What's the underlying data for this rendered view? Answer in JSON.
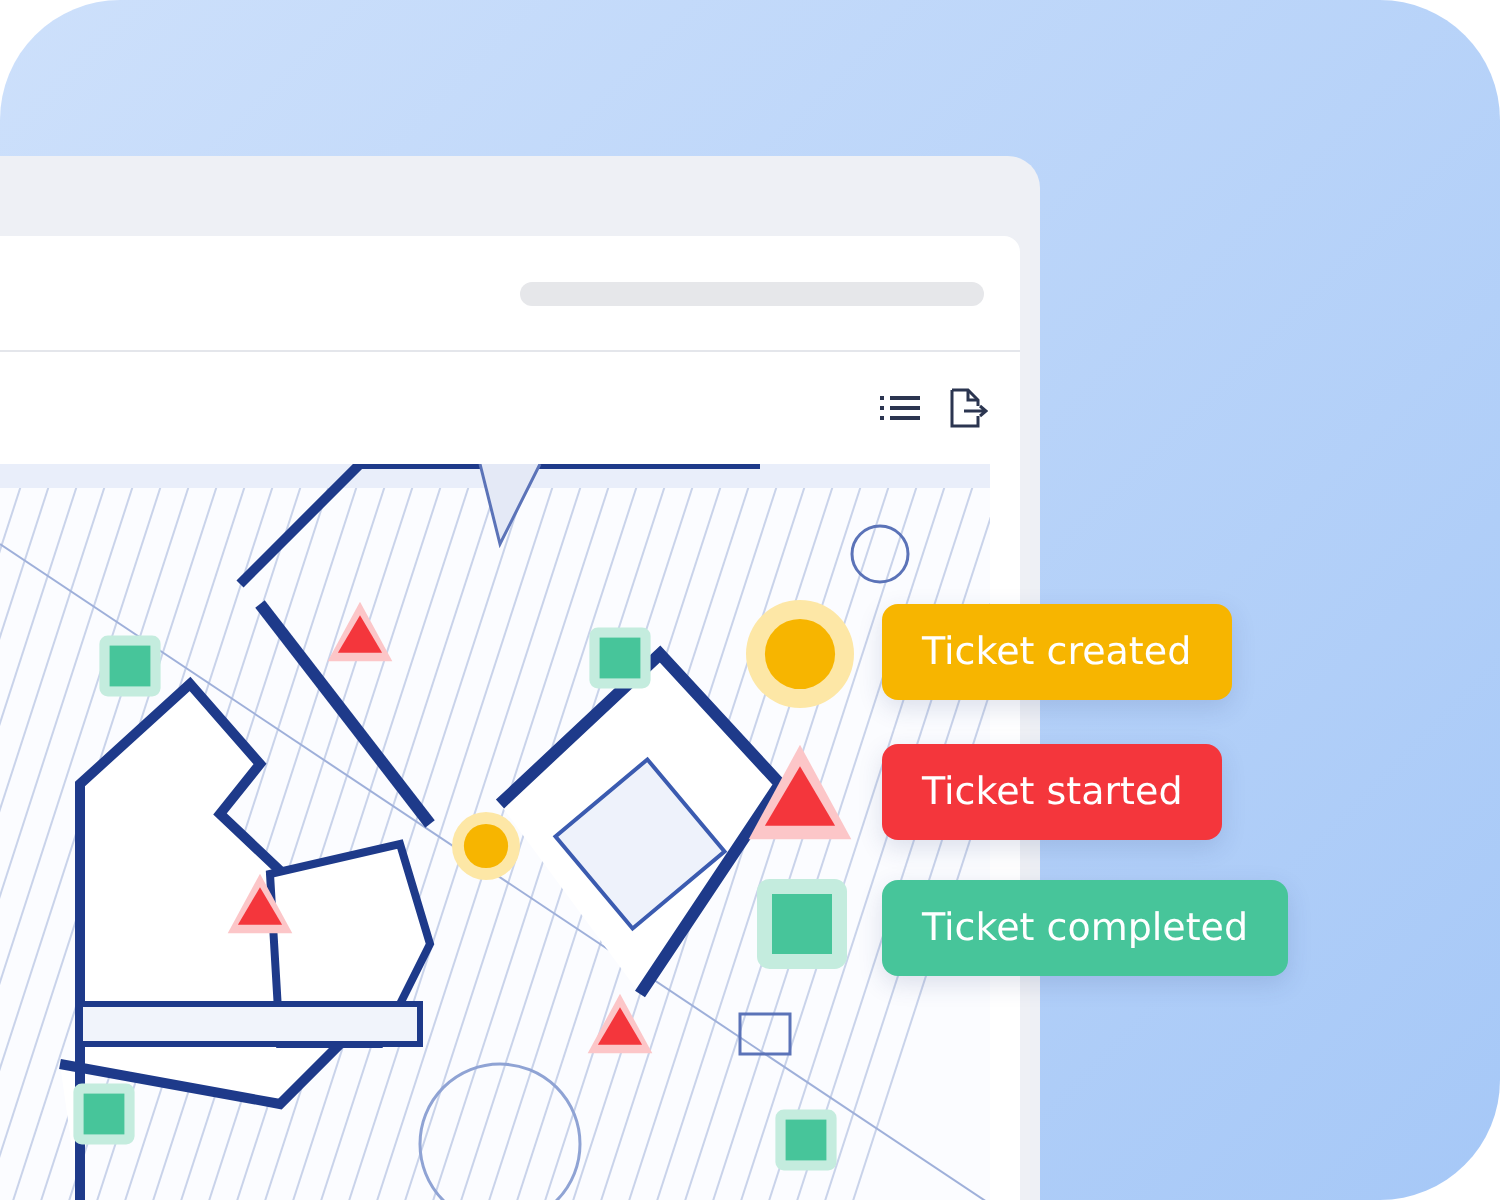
{
  "markers": [
    {
      "kind": "square"
    },
    {
      "kind": "triangle"
    },
    {
      "kind": "square"
    },
    {
      "kind": "circle"
    },
    {
      "kind": "circle"
    },
    {
      "kind": "triangle"
    },
    {
      "kind": "triangle"
    },
    {
      "kind": "square"
    },
    {
      "kind": "triangle"
    },
    {
      "kind": "square"
    },
    {
      "kind": "square"
    }
  ],
  "legend": [
    {
      "kind": "circle",
      "label": "Ticket created"
    },
    {
      "kind": "triangle",
      "label": "Ticket started"
    },
    {
      "kind": "square",
      "label": "Ticket completed"
    }
  ]
}
